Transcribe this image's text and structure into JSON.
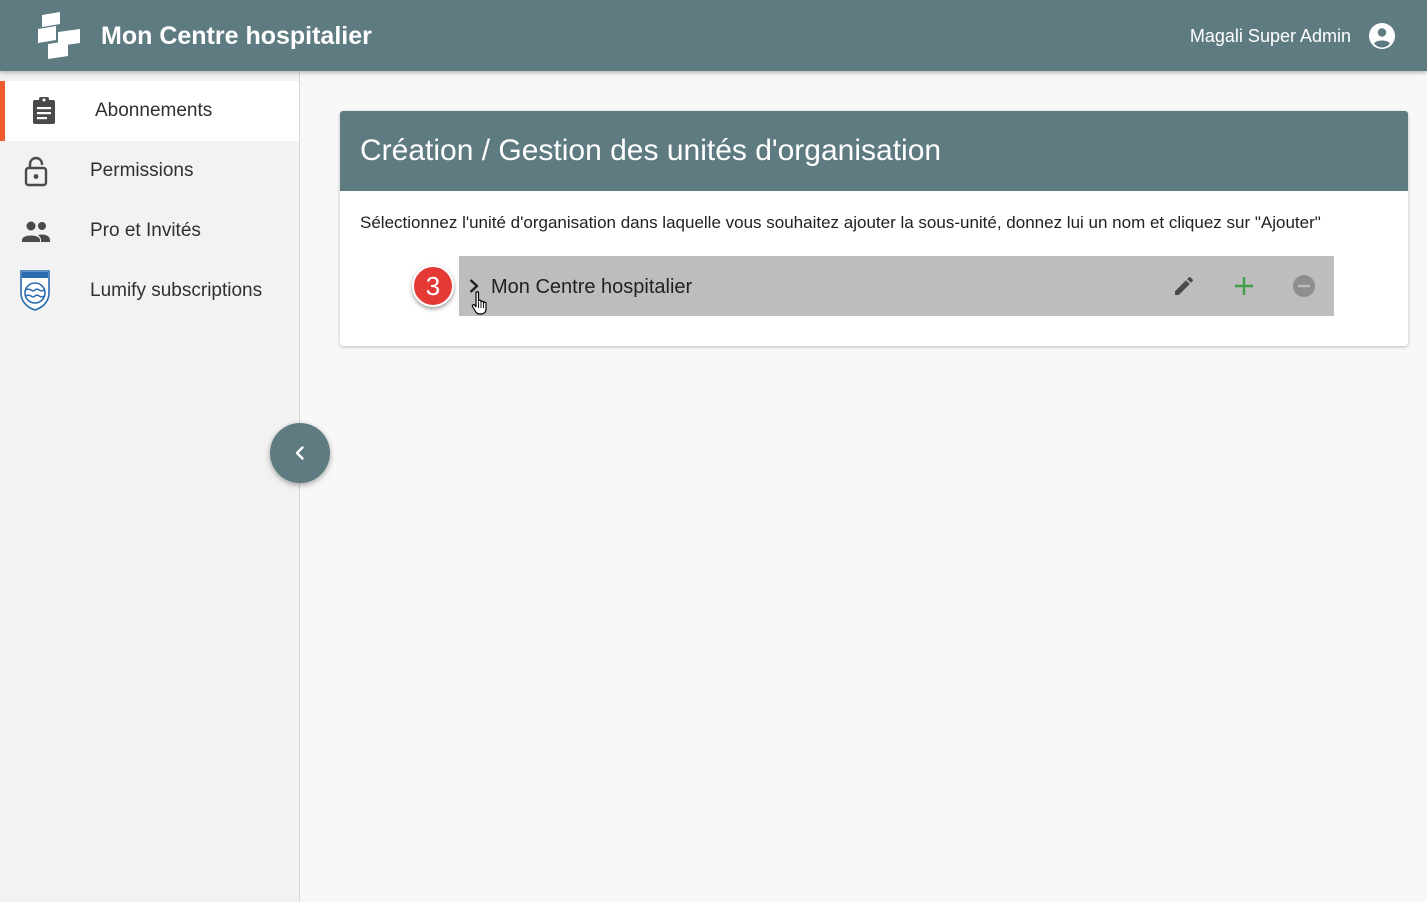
{
  "header": {
    "app_title": "Mon Centre hospitalier",
    "user_name": "Magali Super Admin",
    "logo_icon": "stacked-squares-logo",
    "user_icon": "account-circle-icon",
    "bar_color": "#5f7b82"
  },
  "sidebar": {
    "items": [
      {
        "label": "Abonnements",
        "icon": "clipboard-icon",
        "active": true
      },
      {
        "label": "Permissions",
        "icon": "lock-open-icon",
        "active": false
      },
      {
        "label": "Pro et Invités",
        "icon": "people-icon",
        "active": false
      },
      {
        "label": "Lumify subscriptions",
        "icon": "philips-logo-icon",
        "active": false
      }
    ],
    "active_accent": "#ef5b2b",
    "collapse_icon": "chevron-left-icon"
  },
  "main": {
    "title": "Création / Gestion des unités d'organisation",
    "description": "Sélectionnez l'unité d'organisation dans laquelle vous souhaitez ajouter la sous-unité, donnez lui un nom et cliquez sur \"Ajouter\"",
    "tree": [
      {
        "label": "Mon Centre hospitalier",
        "expand_icon": "chevron-right-icon",
        "actions": [
          "edit-icon",
          "add-icon",
          "remove-icon"
        ]
      }
    ]
  },
  "overlay": {
    "step_number": "3",
    "step_color": "#e53935",
    "cursor": "hand-pointer-cursor"
  }
}
